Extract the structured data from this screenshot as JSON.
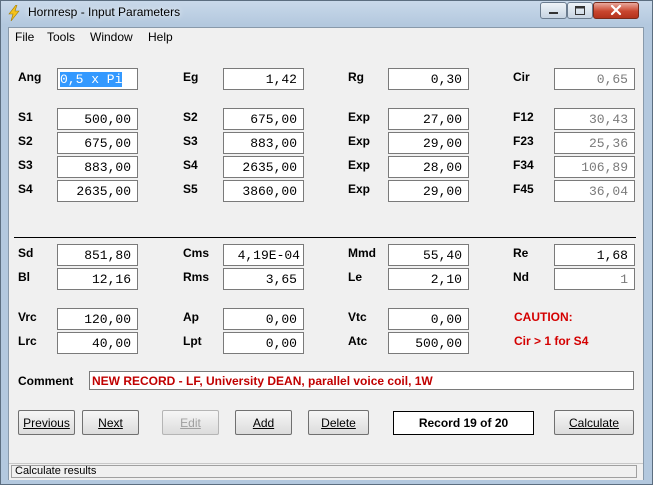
{
  "window": {
    "title": "Hornresp - Input Parameters"
  },
  "menu": [
    "File",
    "Tools",
    "Window",
    "Help"
  ],
  "params": {
    "row1": [
      {
        "label": "Ang",
        "value": "0,5 x Pi",
        "selected": true
      },
      {
        "label": "Eg",
        "value": "1,42"
      },
      {
        "label": "Rg",
        "value": "0,30"
      },
      {
        "label": "Cir",
        "value": "0,65",
        "gray": true
      }
    ],
    "row2": [
      {
        "label": "S1",
        "value": "500,00"
      },
      {
        "label": "S2",
        "value": "675,00"
      },
      {
        "label": "Exp",
        "value": "27,00"
      },
      {
        "label": "F12",
        "value": "30,43",
        "gray": true
      }
    ],
    "row3": [
      {
        "label": "S2",
        "value": "675,00"
      },
      {
        "label": "S3",
        "value": "883,00"
      },
      {
        "label": "Exp",
        "value": "29,00"
      },
      {
        "label": "F23",
        "value": "25,36",
        "gray": true
      }
    ],
    "row4": [
      {
        "label": "S3",
        "value": "883,00"
      },
      {
        "label": "S4",
        "value": "2635,00"
      },
      {
        "label": "Exp",
        "value": "28,00"
      },
      {
        "label": "F34",
        "value": "106,89",
        "gray": true
      }
    ],
    "row5": [
      {
        "label": "S4",
        "value": "2635,00"
      },
      {
        "label": "S5",
        "value": "3860,00"
      },
      {
        "label": "Exp",
        "value": "29,00"
      },
      {
        "label": "F45",
        "value": "36,04",
        "gray": true
      }
    ],
    "row6": [
      {
        "label": "Sd",
        "value": "851,80"
      },
      {
        "label": "Cms",
        "value": "4,19E-04"
      },
      {
        "label": "Mmd",
        "value": "55,40"
      },
      {
        "label": "Re",
        "value": "1,68"
      }
    ],
    "row7": [
      {
        "label": "Bl",
        "value": "12,16"
      },
      {
        "label": "Rms",
        "value": "3,65"
      },
      {
        "label": "Le",
        "value": "2,10"
      },
      {
        "label": "Nd",
        "value": "1",
        "gray": true
      }
    ],
    "row8": [
      {
        "label": "Vrc",
        "value": "120,00"
      },
      {
        "label": "Ap",
        "value": "0,00"
      },
      {
        "label": "Vtc",
        "value": "0,00"
      }
    ],
    "row9": [
      {
        "label": "Lrc",
        "value": "40,00"
      },
      {
        "label": "Lpt",
        "value": "0,00"
      },
      {
        "label": "Atc",
        "value": "500,00"
      }
    ]
  },
  "caution": {
    "title": "CAUTION:",
    "message": "Cir > 1 for S4"
  },
  "comment": {
    "label": "Comment",
    "value": "NEW RECORD - LF, University DEAN,  parallel voice coil, 1W"
  },
  "buttons": {
    "previous": "Previous",
    "next": "Next",
    "edit": "Edit",
    "add": "Add",
    "delete": "Delete",
    "calculate": "Calculate"
  },
  "record": "Record 19 of 20",
  "status": "Calculate results",
  "colors": {
    "caution": "#d40000",
    "comment": "#c00000",
    "selection": "#3399ff"
  }
}
